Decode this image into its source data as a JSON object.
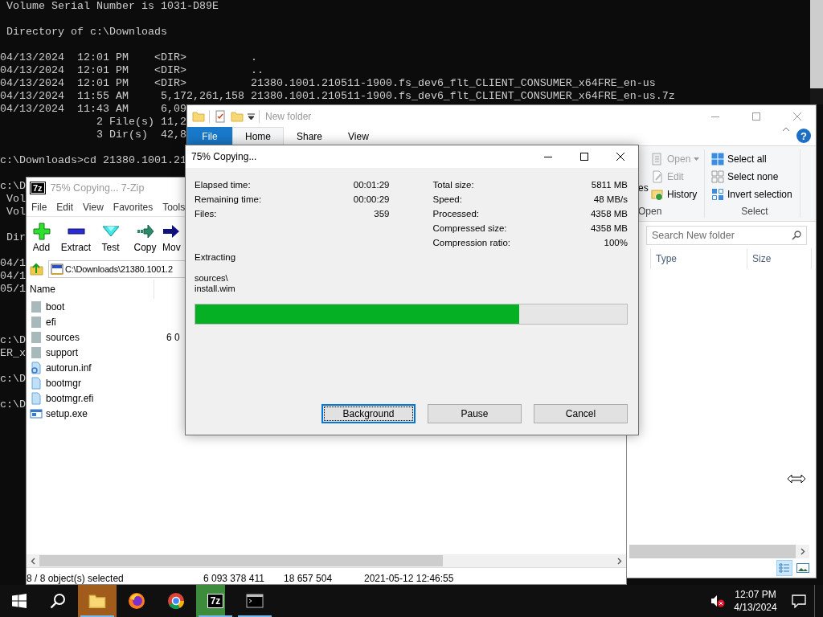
{
  "console": {
    "lines": [
      {
        "kind": "text",
        "text": " Volume Serial Number is 1031-D89E"
      },
      {
        "kind": "blank"
      },
      {
        "kind": "text",
        "text": " Directory of c:\\Downloads"
      },
      {
        "kind": "blank"
      },
      {
        "kind": "text",
        "text": "04/13/2024  12:01 PM    <DIR>          ."
      },
      {
        "kind": "text",
        "text": "04/13/2024  12:01 PM    <DIR>          .."
      },
      {
        "kind": "text",
        "text": "04/13/2024  12:01 PM    <DIR>          21380.1001.210511-1900.fs_dev6_flt_CLIENT_CONSUMER_x64FRE_en-us"
      },
      {
        "kind": "text",
        "text": "04/13/2024  11:55 AM     5,172,261,158 21380.1001.210511-1900.fs_dev6_flt_CLIENT_CONSUMER_x64FRE_en-us.7z"
      },
      {
        "kind": "text",
        "text": "04/13/2024  11:43 AM     6,09"
      },
      {
        "kind": "text",
        "text": "               2 File(s) 11,2"
      },
      {
        "kind": "text",
        "text": "               3 Dir(s)  42,8"
      },
      {
        "kind": "blank"
      },
      {
        "kind": "text",
        "text": "c:\\Downloads>cd 21380.1001.21"
      },
      {
        "kind": "blank"
      },
      {
        "kind": "text",
        "text": "c:\\D"
      },
      {
        "kind": "text",
        "text": " Vol"
      },
      {
        "kind": "text",
        "text": " Vol"
      },
      {
        "kind": "blank"
      },
      {
        "kind": "text",
        "text": " Dir"
      },
      {
        "kind": "blank"
      },
      {
        "kind": "text",
        "text": "04/1"
      },
      {
        "kind": "text",
        "text": "04/1"
      },
      {
        "kind": "text",
        "text": "05/1"
      },
      {
        "kind": "blank"
      },
      {
        "kind": "blank"
      },
      {
        "kind": "blank"
      },
      {
        "kind": "text",
        "text": "c:\\D"
      },
      {
        "kind": "text",
        "text": "ER_x"
      },
      {
        "kind": "blank"
      },
      {
        "kind": "text",
        "text": "c:\\D"
      },
      {
        "kind": "blank"
      },
      {
        "kind": "text",
        "text": "c:\\D"
      }
    ]
  },
  "explorer": {
    "title": "New folder",
    "file_tab": "File",
    "tabs": [
      {
        "label": "Home",
        "selected": true
      },
      {
        "label": "Share",
        "selected": false
      },
      {
        "label": "View",
        "selected": false
      }
    ],
    "help_button": "?",
    "ribbon": {
      "cut_label": "es",
      "open_group": {
        "label": "Open",
        "items": [
          {
            "label": "Open",
            "kind": "open",
            "disabled": true
          },
          {
            "label": "Edit",
            "kind": "edit",
            "disabled": true
          },
          {
            "label": "History",
            "kind": "history",
            "disabled": false
          }
        ]
      },
      "select_group": {
        "label": "Select",
        "items": [
          {
            "label": "Select all",
            "kind": "select_all"
          },
          {
            "label": "Select none",
            "kind": "select_none"
          },
          {
            "label": "Invert selection",
            "kind": "invert"
          }
        ]
      }
    },
    "search": {
      "placeholder": "Search New folder"
    },
    "columns": [
      "Type",
      "Size"
    ],
    "views": [
      {
        "kind": "details",
        "selected": true
      },
      {
        "kind": "large_icons",
        "selected": false
      }
    ]
  },
  "sevenzip": {
    "logo": "7z",
    "title": "75% Copying... 7-Zip",
    "menu": [
      "File",
      "Edit",
      "View",
      "Favorites",
      "Tools"
    ],
    "toolbar": [
      {
        "label": "Add",
        "kind": "add"
      },
      {
        "label": "Extract",
        "kind": "extract"
      },
      {
        "label": "Test",
        "kind": "test"
      },
      {
        "label": "Copy",
        "kind": "copy"
      },
      {
        "label": "Mov",
        "kind": "move"
      }
    ],
    "path": "C:\\Downloads\\21380.1001.2",
    "columns": [
      "Name"
    ],
    "files": [
      {
        "name": "boot",
        "kind": "folder"
      },
      {
        "name": "efi",
        "kind": "folder"
      },
      {
        "name": "sources",
        "kind": "folder",
        "size": "6 0"
      },
      {
        "name": "support",
        "kind": "folder"
      },
      {
        "name": "autorun.inf",
        "kind": "settings"
      },
      {
        "name": "bootmgr",
        "kind": "file"
      },
      {
        "name": "bootmgr.efi",
        "kind": "file"
      },
      {
        "name": "setup.exe",
        "kind": "program"
      }
    ],
    "status": [
      "8 / 8 object(s) selected",
      "6 093 378 411",
      "18 657 504",
      "2021-05-12 12:46:55"
    ]
  },
  "dialog": {
    "title": "75% Copying...",
    "stats_left": [
      {
        "label": "Elapsed time:",
        "value": "00:01:29"
      },
      {
        "label": "Remaining time:",
        "value": "00:00:29"
      },
      {
        "label": "Files:",
        "value": "359"
      }
    ],
    "stats_right": [
      {
        "label": "Total size:",
        "value": "5811 MB"
      },
      {
        "label": "Speed:",
        "value": "48 MB/s"
      },
      {
        "label": "Processed:",
        "value": "4358 MB"
      },
      {
        "label": "Compressed size:",
        "value": "4358 MB"
      },
      {
        "label": "Compression ratio:",
        "value": "100%"
      }
    ],
    "operation": "Extracting",
    "current_path": "sources\\",
    "current_file": "install.wim",
    "progress": {
      "level": 0.75
    },
    "buttons": [
      {
        "label": "Background",
        "focused": true
      },
      {
        "label": "Pause",
        "focused": false
      },
      {
        "label": "Cancel",
        "focused": false
      }
    ]
  },
  "taskbar": {
    "apps": [
      {
        "kind": "explorer",
        "flashing": true,
        "running": true
      },
      {
        "kind": "firefox",
        "flashing": false,
        "running": false
      },
      {
        "kind": "chrome",
        "flashing": false,
        "running": false
      },
      {
        "kind": "sevenzip",
        "label": "7z",
        "flashing": false,
        "running": true,
        "level": 0.75
      },
      {
        "kind": "console",
        "flashing": false,
        "running": true
      }
    ],
    "volume_muted": true,
    "time": "12:07 PM",
    "date": "4/13/2024"
  }
}
